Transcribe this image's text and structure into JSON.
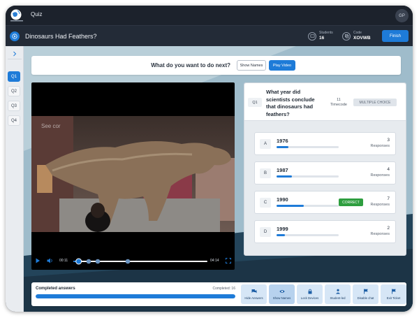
{
  "app": {
    "logo_text": "DISCOVERY\nEDUCATION",
    "title": "Quiz",
    "user_initials": "GP"
  },
  "header": {
    "quiz_title": "Dinosaurs Had Feathers?",
    "students_label": "Students",
    "students_value": "16",
    "code_label": "Code",
    "code_value": "XOVWB",
    "finish_label": "Finish"
  },
  "sidebar": {
    "items": [
      {
        "label": "Q1",
        "active": true
      },
      {
        "label": "Q2",
        "active": false
      },
      {
        "label": "Q3",
        "active": false
      },
      {
        "label": "Q4",
        "active": false
      }
    ]
  },
  "action_bar": {
    "prompt": "What do you want to do next?",
    "show_names_label": "Show Names",
    "play_video_label": "Play Video"
  },
  "video": {
    "watermark": "See cor",
    "current_time": "00:11",
    "duration": "04:14",
    "progress_fraction": 0.04
  },
  "question": {
    "number": "Q1",
    "text": "What year did scientists conclude that dinosaurs had feathers?",
    "timecode_value": "11",
    "timecode_label": "Timecode",
    "type_label": "MULTIPLE CHOICE",
    "answers": [
      {
        "letter": "A",
        "text": "1976",
        "responses": "3",
        "responses_label": "Responses",
        "fraction": 0.19,
        "correct": false
      },
      {
        "letter": "B",
        "text": "1987",
        "responses": "4",
        "responses_label": "Responses",
        "fraction": 0.25,
        "correct": false
      },
      {
        "letter": "C",
        "text": "1990",
        "responses": "7",
        "responses_label": "Responses",
        "fraction": 0.44,
        "correct": true,
        "correct_label": "CORRECT"
      },
      {
        "letter": "D",
        "text": "1999",
        "responses": "2",
        "responses_label": "Responses",
        "fraction": 0.13,
        "correct": false
      }
    ]
  },
  "completion": {
    "label": "Completed answers",
    "count_text": "Completed: 16",
    "fraction": 1.0
  },
  "tools": [
    {
      "label": "Hide Answers",
      "icon": "chat-icon",
      "active": false
    },
    {
      "label": "Show Names",
      "icon": "eye-icon",
      "active": true
    },
    {
      "label": "Lock Devices",
      "icon": "lock-icon",
      "active": false
    },
    {
      "label": "Student-led",
      "icon": "student-icon",
      "active": false
    },
    {
      "label": "Disable chat",
      "icon": "flag-icon",
      "active": false
    },
    {
      "label": "Exit Ticket",
      "icon": "flag-icon",
      "active": false
    }
  ],
  "colors": {
    "accent": "#1e7bd8",
    "correct": "#2e9e3f",
    "topbar": "#1c222c",
    "header": "#232b37"
  }
}
